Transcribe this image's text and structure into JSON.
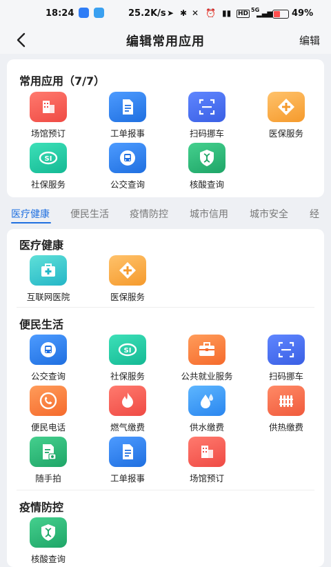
{
  "status": {
    "time": "18:24",
    "speed": "25.2K/s",
    "network": "5G",
    "battery": "49%",
    "battery_level": 0.49
  },
  "nav": {
    "title": "编辑常用应用",
    "edit": "编辑"
  },
  "favorites": {
    "title": "常用应用（7/7）",
    "apps": [
      {
        "label": "场馆预订",
        "icon": "building-icon",
        "color": "#ef4a44"
      },
      {
        "label": "工单报事",
        "icon": "document-icon",
        "color": "#1f6fe0"
      },
      {
        "label": "扫码挪车",
        "icon": "scan-icon",
        "color": "#3a5fe4"
      },
      {
        "label": "医保服务",
        "icon": "medical-plus-icon",
        "color": "#f59a2c"
      },
      {
        "label": "社保服务",
        "icon": "social-security-icon",
        "color": "#14b994"
      },
      {
        "label": "公交查询",
        "icon": "bus-icon",
        "color": "#1f6fe0"
      },
      {
        "label": "核酸查询",
        "icon": "dna-icon",
        "color": "#1ea567"
      }
    ]
  },
  "tabs": [
    "医疗健康",
    "便民生活",
    "疫情防控",
    "城市信用",
    "城市安全",
    "经"
  ],
  "sections": {
    "medical": {
      "title": "医疗健康",
      "apps": [
        {
          "label": "互联网医院",
          "icon": "medical-kit-icon"
        },
        {
          "label": "医保服务",
          "icon": "medical-plus-icon"
        }
      ]
    },
    "living": {
      "title": "便民生活",
      "apps": [
        {
          "label": "公交查询",
          "icon": "bus-icon"
        },
        {
          "label": "社保服务",
          "icon": "social-security-icon"
        },
        {
          "label": "公共就业服务",
          "icon": "briefcase-icon"
        },
        {
          "label": "扫码挪车",
          "icon": "scan-icon"
        },
        {
          "label": "便民电话",
          "icon": "phone-icon"
        },
        {
          "label": "燃气缴费",
          "icon": "flame-icon"
        },
        {
          "label": "供水缴费",
          "icon": "water-drop-icon"
        },
        {
          "label": "供热缴费",
          "icon": "radiator-icon"
        },
        {
          "label": "随手拍",
          "icon": "camera-report-icon"
        },
        {
          "label": "工单报事",
          "icon": "document-icon"
        },
        {
          "label": "场馆预订",
          "icon": "building-icon"
        }
      ]
    },
    "epidemic": {
      "title": "疫情防控",
      "apps": [
        {
          "label": "核酸查询",
          "icon": "dna-icon"
        }
      ]
    }
  }
}
